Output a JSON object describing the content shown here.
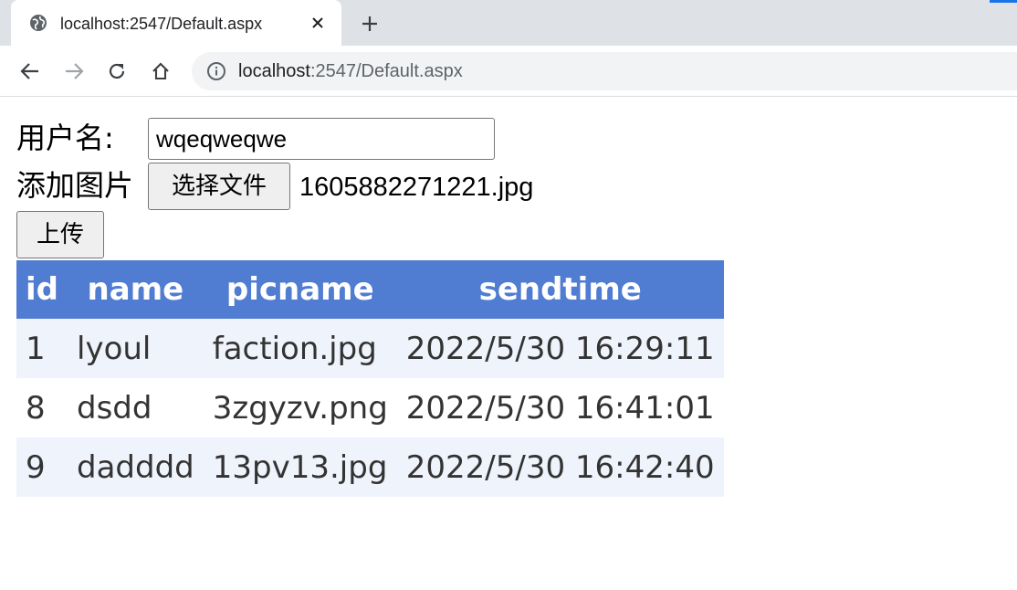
{
  "browser": {
    "tab_title": "localhost:2547/Default.aspx",
    "url_host": "localhost",
    "url_rest": ":2547/Default.aspx",
    "accent_color": "#1a73e8"
  },
  "form": {
    "username_label": "用户名:",
    "username_value": "wqeqweqwe",
    "image_label": "添加图片",
    "file_button_label": "选择文件",
    "file_name": "1605882271221.jpg",
    "upload_button_label": "上传"
  },
  "table": {
    "header_color": "#507cd1",
    "alt_row_color": "#eff3fb",
    "columns": [
      "id",
      "name",
      "picname",
      "sendtime"
    ],
    "rows": [
      [
        "1",
        "lyoul",
        "faction.jpg",
        "2022/5/30 16:29:11"
      ],
      [
        "8",
        "dsdd",
        "3zgyzv.png",
        "2022/5/30 16:41:01"
      ],
      [
        "9",
        "dadddd",
        "13pv13.jpg",
        "2022/5/30 16:42:40"
      ]
    ]
  }
}
